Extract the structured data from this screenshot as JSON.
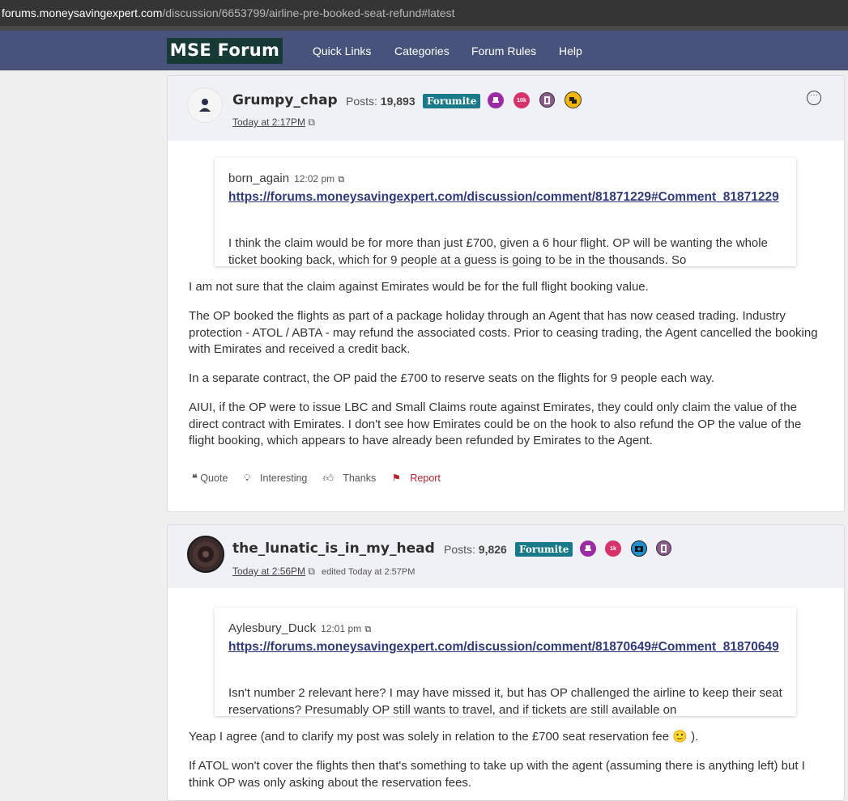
{
  "browser": {
    "url_host": "forums.moneysavingexpert.com",
    "url_path": "/discussion/6653799/airline-pre-booked-seat-refund#latest"
  },
  "nav": {
    "logo": "MSE Forum",
    "links": [
      "Quick Links",
      "Categories",
      "Forum Rules",
      "Help"
    ]
  },
  "posts": [
    {
      "author": "Grumpy_chap",
      "posts_label": "Posts:",
      "posts_count": "19,893",
      "rank": "Forumite",
      "badges": [
        "10k"
      ],
      "timestamp": "Today at 2:17PM",
      "quote": {
        "author": "born_again",
        "time": "12:02 pm",
        "link": "https://forums.moneysavingexpert.com/discussion/comment/81871229#Comment_81871229",
        "text": "I think the claim would be for more than just £700, given a 6 hour flight. OP will be wanting the whole ticket booking back, which for 9 people at a guess is going to be in the thousands. So"
      },
      "paragraphs": [
        "I am not sure that the claim against Emirates would be for the full flight booking value.",
        "The OP booked the flights as part of a package holiday through an Agent that has now ceased trading. Industry protection - ATOL / ABTA - may refund the associated costs. Prior to ceasing trading, the Agent cancelled the booking with Emirates and received a credit back.",
        "In a separate contract, the OP paid the £700 to reserve seats on the flights for 9 people each way.",
        "AIUI, if the OP were to issue LBC and Small Claims route against Emirates, they could only claim the value of the direct contract with Emirates. I don't see how Emirates could be on the hook to also refund the OP the value of the flight booking, which appears to have already been refunded by Emirates to the Agent."
      ],
      "actions": {
        "quote": "Quote",
        "interesting": "Interesting",
        "thanks": "Thanks",
        "report": "Report"
      }
    },
    {
      "author": "the_lunatic_is_in_my_head",
      "posts_label": "Posts:",
      "posts_count": "9,826",
      "rank": "Forumite",
      "badges": [
        "1k"
      ],
      "timestamp": "Today at 2:56PM",
      "edited": "edited Today at 2:57PM",
      "quote": {
        "author": "Aylesbury_Duck",
        "time": "12:01 pm",
        "link": "https://forums.moneysavingexpert.com/discussion/comment/81870649#Comment_81870649",
        "text": "Isn't number 2 relevant here? I may have missed it, but has OP challenged the airline to keep their seat reservations? Presumably OP still wants to travel, and if tickets are still available on"
      },
      "paragraphs": [
        "Yeap I agree (and to clarify my post was solely in relation to the £700 seat reservation fee 🙂 ).",
        "If ATOL won't cover the flights then that's something to take up with the agent (assuming there is anything left) but I think OP was only asking about the reservation fees."
      ]
    }
  ],
  "colors": {
    "navbar": "#48537b",
    "logo_bg": "#173a36",
    "rank_bg": "#1a7a8a",
    "link": "#2f3a78",
    "report": "#b0242c"
  }
}
